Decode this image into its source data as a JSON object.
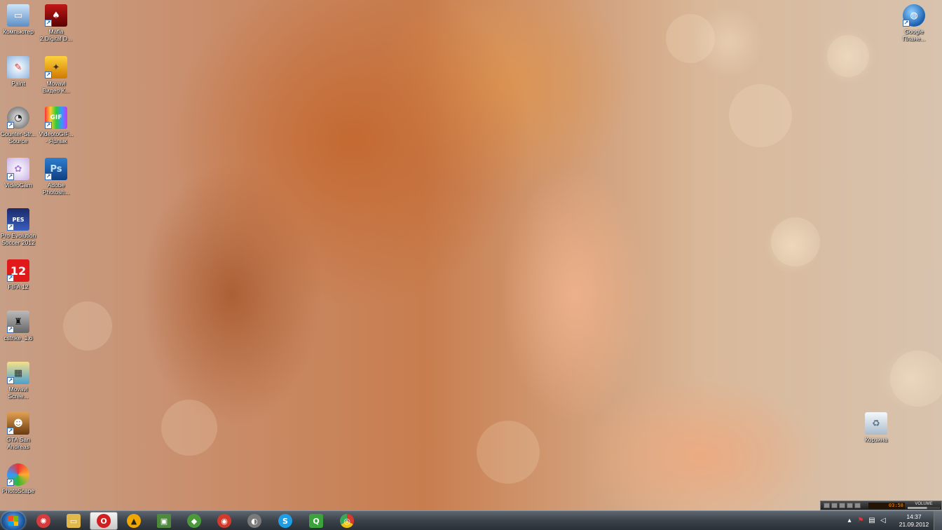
{
  "desktop": {
    "icons": [
      {
        "label": "Компьютер",
        "icon": "computer-icon"
      },
      {
        "label": "Mafia\n2.Digital D...",
        "icon": "mafia-icon"
      },
      {
        "label": "Paint",
        "icon": "paint-icon"
      },
      {
        "label": "Movavi\nВидео К...",
        "icon": "movavi-video-icon"
      },
      {
        "label": "Counter-Str...\nSource",
        "icon": "counter-strike-source-icon"
      },
      {
        "label": "VideotoGIF...\n- Ярлык",
        "icon": "video-to-gif-icon"
      },
      {
        "label": "VideoCam",
        "icon": "videocam-icon"
      },
      {
        "label": "Adobe\nPhotosh...",
        "icon": "photoshop-icon"
      },
      {
        "label": "Pro Evolution\nSoccer 2012",
        "icon": "pes-icon"
      },
      {
        "label": "FIFA 12",
        "icon": "fifa-icon"
      },
      {
        "label": "cstrike_1.6",
        "icon": "cstrike-icon"
      },
      {
        "label": "Movavi\nScree...",
        "icon": "movavi-screen-icon"
      },
      {
        "label": "GTA San\nAndreas",
        "icon": "gta-icon"
      },
      {
        "label": "PhotoScape",
        "icon": "photoscape-icon"
      },
      {
        "label": "Google\nПлане...",
        "icon": "google-earth-icon"
      },
      {
        "label": "Корзина",
        "icon": "recycle-bin-icon"
      }
    ]
  },
  "taskbar": {
    "pinned": [
      {
        "name": "opera-gx-icon",
        "glyph": "✺",
        "color": "#d83b3b"
      },
      {
        "name": "explorer-icon",
        "glyph": "▭",
        "color": "#e2b84a"
      },
      {
        "name": "opera-icon",
        "glyph": "O",
        "color": "#d11f1f"
      },
      {
        "name": "aimp-icon",
        "glyph": "▲",
        "color": "#f0a800"
      },
      {
        "name": "monitor-icon",
        "glyph": "▣",
        "color": "#4d8a3c"
      },
      {
        "name": "shield-icon",
        "glyph": "◆",
        "color": "#4a9a3a"
      },
      {
        "name": "racing-icon",
        "glyph": "◉",
        "color": "#d43a2a"
      },
      {
        "name": "media-icon",
        "glyph": "◐",
        "color": "#7a7a7a"
      },
      {
        "name": "skype-icon",
        "glyph": "S",
        "color": "#1f9ee6"
      },
      {
        "name": "qip-icon",
        "glyph": "Q",
        "color": "#3aa33a"
      },
      {
        "name": "chrome-icon",
        "glyph": "◎",
        "color": "#e0a020"
      }
    ],
    "player": {
      "time": "03:58",
      "volume_label": "VOLUME"
    },
    "clock": {
      "time": "14:37",
      "date": "21.09.2012"
    }
  }
}
